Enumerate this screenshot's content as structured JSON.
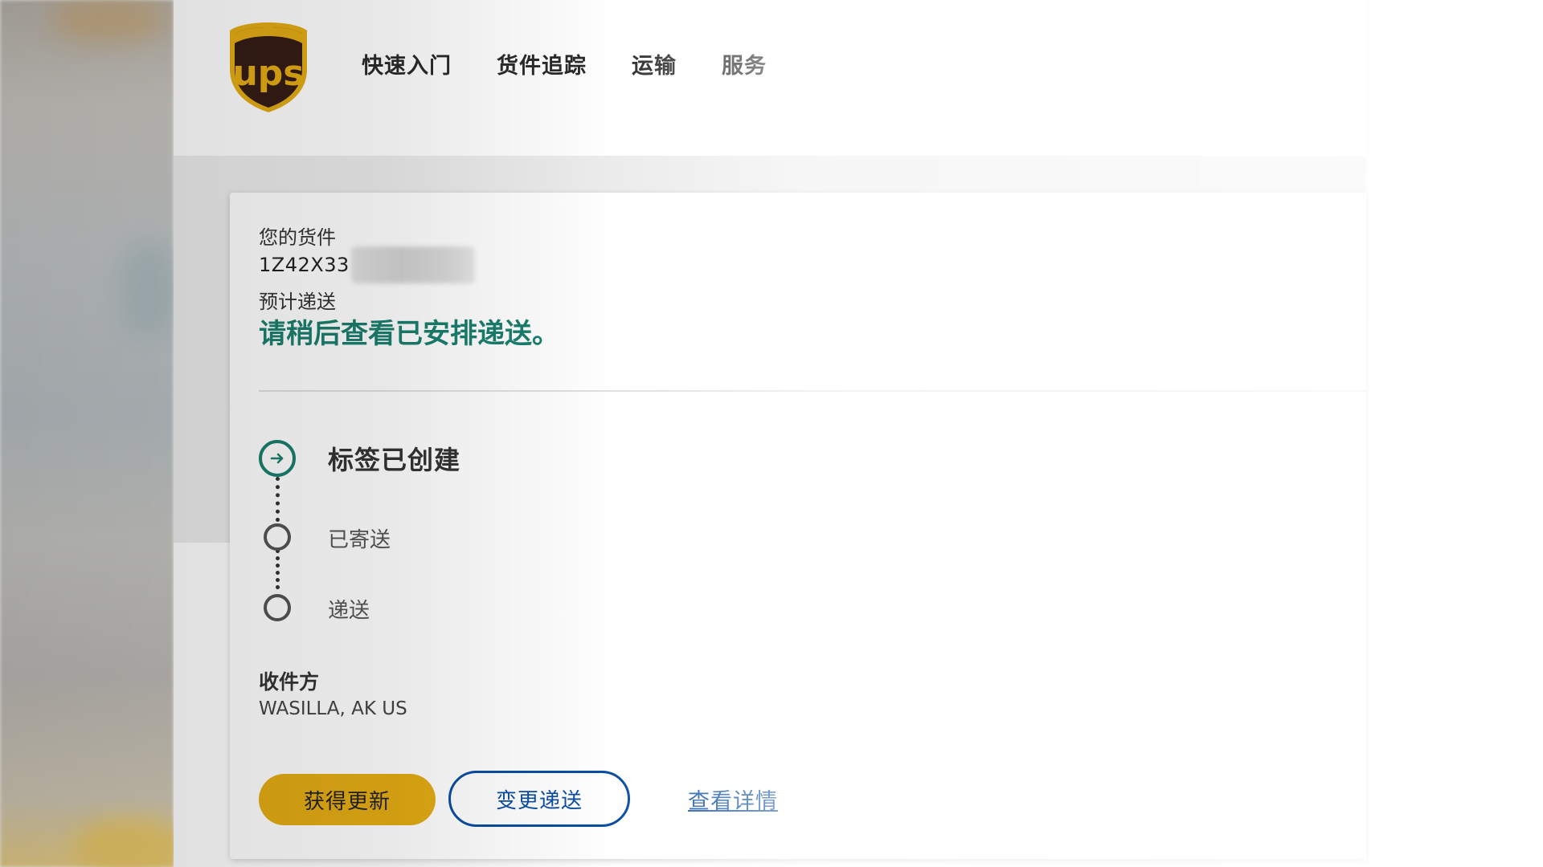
{
  "header": {
    "logo_text": "ups",
    "nav": [
      {
        "label": "快速入门"
      },
      {
        "label": "货件追踪"
      },
      {
        "label": "运输"
      },
      {
        "label": "服务"
      }
    ]
  },
  "shipment": {
    "label": "您的货件",
    "tracking_number_visible": "1Z42X33",
    "estimated_label": "预计递送",
    "estimated_value": "请稍后查看已安排递送。"
  },
  "progress": {
    "steps": [
      {
        "label": "标签已创建",
        "status": "current"
      },
      {
        "label": "已寄送",
        "status": "pending"
      },
      {
        "label": "递送",
        "status": "pending"
      }
    ]
  },
  "recipient": {
    "label": "收件方",
    "location": "WASILLA, AK US"
  },
  "actions": {
    "get_updates": "获得更新",
    "change_delivery": "变更递送",
    "view_details": "查看详情"
  },
  "colors": {
    "brand_brown": "#351c15",
    "brand_gold": "#e4ac14",
    "status_green": "#1a7f6e",
    "link_blue": "#0b4da2"
  }
}
